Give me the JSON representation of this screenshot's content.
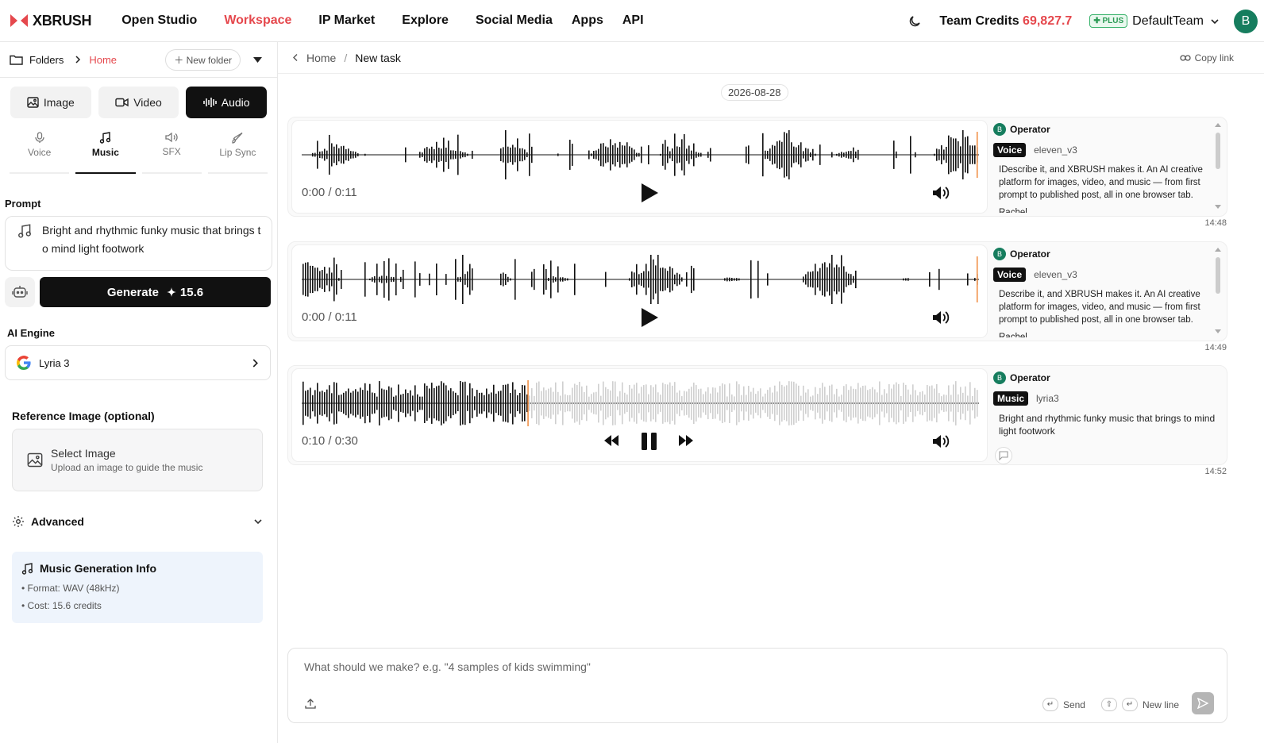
{
  "brand": {
    "name": "XBRUSH"
  },
  "nav": [
    "Open Studio",
    "Workspace",
    "IP Market",
    "Explore",
    "Social Media",
    "Apps",
    "API"
  ],
  "topbar": {
    "credits_label": "Team Credits",
    "credits_value": "69,827.7",
    "plan_badge": "PLUS",
    "team": "DefaultTeam",
    "avatar_initial": "B"
  },
  "sidebar": {
    "folders_label": "Folders",
    "home_label": "Home",
    "new_folder": "New folder",
    "media_tabs": [
      "Image",
      "Video",
      "Audio"
    ],
    "sub_tabs": [
      "Voice",
      "Music",
      "SFX",
      "Lip Sync"
    ],
    "prompt_label": "Prompt",
    "prompt_text": "Bright and rhythmic funky music that brings to mind light footwork",
    "generate_label": "Generate",
    "generate_cost": "15.6",
    "engine_label": "AI Engine",
    "engine_name": "Lyria 3",
    "reference_label": "Reference Image (optional)",
    "select_image": "Select Image",
    "select_image_hint": "Upload an image to guide the music",
    "advanced": "Advanced",
    "info_title": "Music Generation Info",
    "info_format": "• Format: WAV (48kHz)",
    "info_cost": "• Cost: 15.6 credits"
  },
  "main": {
    "breadcrumb_home": "Home",
    "breadcrumb_current": "New task",
    "copy_link": "Copy link",
    "date": "2026-08-28",
    "items": [
      {
        "time": "0:00 / 0:11",
        "progress": 0,
        "operator": "Operator",
        "tag": "Voice",
        "model": "eleven_v3",
        "description": "IDescribe it, and XBRUSH makes it. An AI creative platform for images, video, and music — from first prompt to published post, all in one browser tab.",
        "voice": "Rachel",
        "stamp": "14:48"
      },
      {
        "time": "0:00 / 0:11",
        "progress": 0,
        "operator": "Operator",
        "tag": "Voice",
        "model": "eleven_v3",
        "description": "Describe it, and XBRUSH makes it. An AI creative platform for images, video, and music — from first prompt to published post, all in one browser tab.",
        "voice": "Rachel",
        "stamp": "14:49"
      },
      {
        "time": "0:10 / 0:30",
        "progress": 0.3333,
        "operator": "Operator",
        "tag": "Music",
        "model": "lyria3",
        "description": "Bright and rhythmic funky music that brings to mind light footwork",
        "voice": "",
        "stamp": "14:52"
      }
    ],
    "composer_placeholder": "What should we make? e.g. \"4 samples of kids swimming\"",
    "send_label": "Send",
    "newline_label": "New line"
  },
  "colors": {
    "accent": "#e5484d",
    "avatar": "#167d5e",
    "progress": "#f08a3c"
  }
}
